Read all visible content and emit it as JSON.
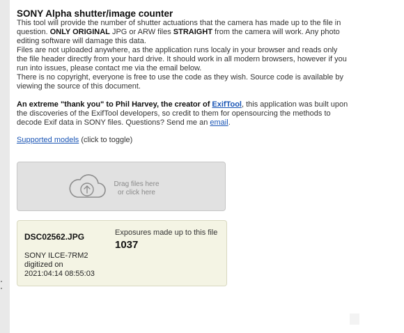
{
  "header": {
    "title": "SONY Alpha shutter/image counter"
  },
  "intro": {
    "p1_a": "This tool will provide the number of shutter actuations that the camera has made up to the file in question. ",
    "p1_b": "ONLY ORIGINAL",
    "p1_c": " JPG or ARW files ",
    "p1_d": "STRAIGHT",
    "p1_e": " from the camera will work. Any photo editing software will damage this data.",
    "p2": "Files are not uploaded anywhere, as the application runs localy in your browser and reads only the file header directly from your hard drive. It should work in all modern browsers, however if you run into issues, please contact me via the email below.",
    "p3": "There is no copyright, everyone is free to use the code as they wish. Source code is available by viewing the source of this document."
  },
  "thanks": {
    "bold": "An extreme \"thank you\" to Phil Harvey, the creator of ",
    "link": "ExifTool",
    "rest": ", this application was built upon the discoveries of the ExifTool developers, so credit to them for opensourcing the methods to decode Exif data in SONY files. Questions? Send me an ",
    "email_link": "email",
    "end": "."
  },
  "models": {
    "link": "Supported models",
    "suffix": " (click to toggle)"
  },
  "dropzone": {
    "line1": "Drag files here",
    "line2": "or click here",
    "icon": "upload-cloud-icon"
  },
  "result": {
    "filename": "DSC02562.JPG",
    "camera": "SONY ILCE-7RM2",
    "digitized_label": "digitized on",
    "digitized_date": "2021:04:14 08:55:03",
    "exposures_label": "Exposures made up to this file",
    "exposures_count": "1037"
  },
  "colors": {
    "link": "#1a55b5",
    "dropzone_bg": "#e1e1e1",
    "result_bg": "#f4f4e4"
  }
}
